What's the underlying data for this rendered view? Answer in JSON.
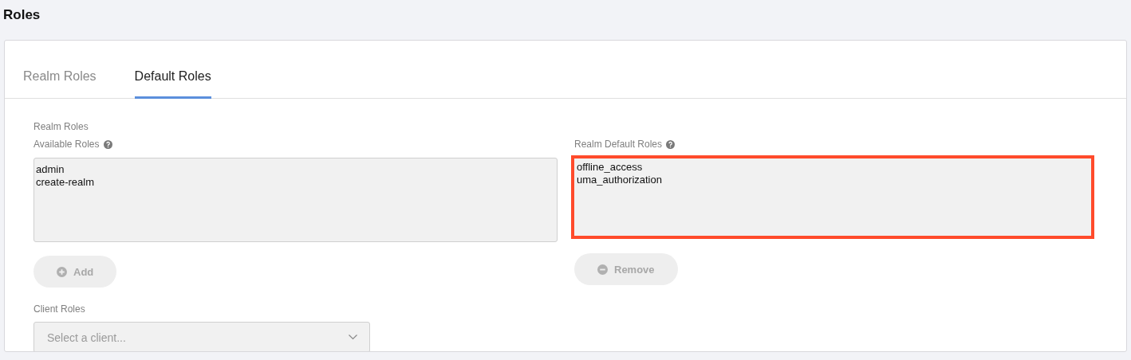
{
  "page_title": "Roles",
  "tabs": [
    {
      "label": "Realm Roles",
      "selected": false
    },
    {
      "label": "Default Roles",
      "selected": true
    }
  ],
  "realm_roles": {
    "heading": "Realm Roles",
    "columns": [
      {
        "label": "Available Roles",
        "items": [
          "admin",
          "create-realm"
        ],
        "highlighted": false,
        "button": {
          "label": "Add",
          "kind": "add",
          "disabled": true
        }
      },
      {
        "label": "Realm Default Roles",
        "items": [
          "offline_access",
          "uma_authorization"
        ],
        "highlighted": true,
        "button": {
          "label": "Remove",
          "kind": "remove",
          "disabled": true
        }
      }
    ]
  },
  "client_roles": {
    "heading": "Client Roles",
    "select": {
      "placeholder": "Select a client..."
    }
  }
}
